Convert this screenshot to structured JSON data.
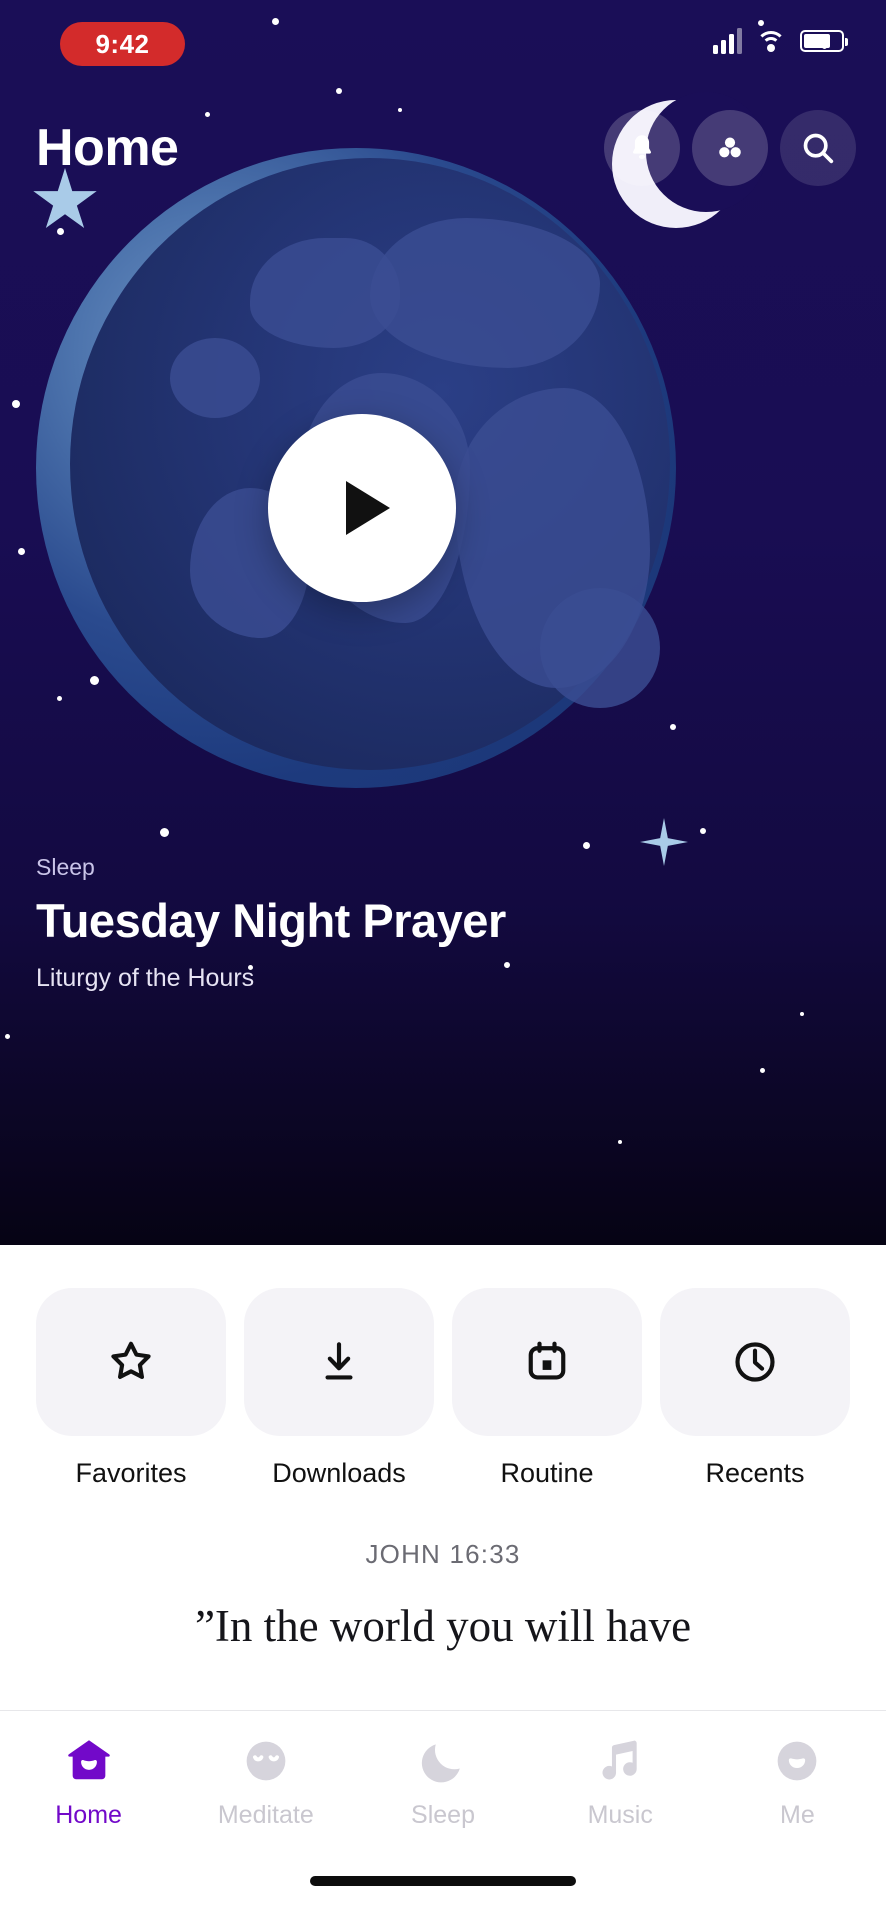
{
  "status_bar": {
    "time": "9:42",
    "icons": [
      "signal-icon",
      "wifi-icon",
      "battery-icon"
    ]
  },
  "header": {
    "title": "Home",
    "actions": [
      {
        "name": "notifications-button",
        "icon": "bell-icon"
      },
      {
        "name": "community-button",
        "icon": "three-circles-icon"
      },
      {
        "name": "search-button",
        "icon": "search-icon"
      }
    ]
  },
  "hero": {
    "play_button_icon": "play-icon",
    "category": "Sleep",
    "title": "Tuesday Night Prayer",
    "subtitle": "Liturgy of the Hours"
  },
  "quick_actions": [
    {
      "label": "Favorites",
      "icon": "star-icon"
    },
    {
      "label": "Downloads",
      "icon": "download-icon"
    },
    {
      "label": "Routine",
      "icon": "calendar-icon"
    },
    {
      "label": "Recents",
      "icon": "clock-icon"
    }
  ],
  "verse": {
    "reference": "JOHN 16:33",
    "text": "”In the world you will have"
  },
  "tabs": [
    {
      "label": "Home",
      "icon": "house-smile-icon",
      "active": true
    },
    {
      "label": "Meditate",
      "icon": "face-closed-eyes-icon",
      "active": false
    },
    {
      "label": "Sleep",
      "icon": "crescent-moon-icon",
      "active": false
    },
    {
      "label": "Music",
      "icon": "music-note-icon",
      "active": false
    },
    {
      "label": "Me",
      "icon": "face-smile-icon",
      "active": false
    }
  ],
  "colors": {
    "accent": "#7209c9",
    "hero_background": "#1a0e57",
    "time_pill": "#d32b2b",
    "tile_background": "#f4f3f7",
    "inactive_tab": "#c9c7cf"
  }
}
